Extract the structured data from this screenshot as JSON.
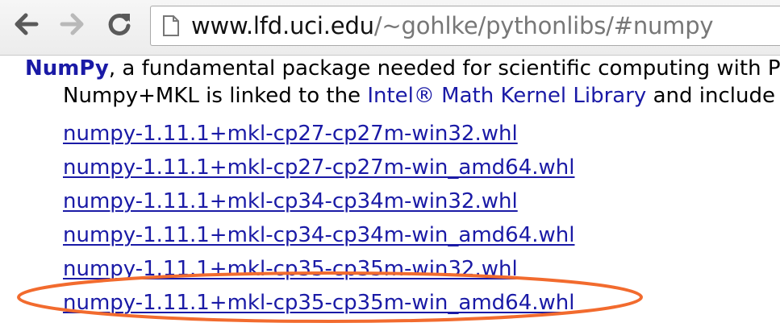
{
  "browser": {
    "back_icon": "back-arrow-icon",
    "forward_icon": "forward-arrow-icon",
    "reload_icon": "reload-icon",
    "page_icon": "page-icon",
    "url_host": "www.lfd.uci.edu",
    "url_path": "/~gohlke/pythonlibs/#numpy"
  },
  "page": {
    "title": "NumPy",
    "description_rest": ", a fundamental package needed for scientific computing with P",
    "line2_before": "Numpy+MKL is linked to the ",
    "line2_link": "Intel® Math Kernel Library",
    "line2_after": " and include",
    "files": [
      "numpy-1.11.1+mkl-cp27-cp27m-win32.whl",
      "numpy-1.11.1+mkl-cp27-cp27m-win_amd64.whl",
      "numpy-1.11.1+mkl-cp34-cp34m-win32.whl",
      "numpy-1.11.1+mkl-cp34-cp34m-win_amd64.whl",
      "numpy-1.11.1+mkl-cp35-cp35m-win32.whl",
      "numpy-1.11.1+mkl-cp35-cp35m-win_amd64.whl"
    ]
  },
  "colors": {
    "link": "#1a1aa6",
    "highlight_ellipse": "#f26b2e"
  }
}
